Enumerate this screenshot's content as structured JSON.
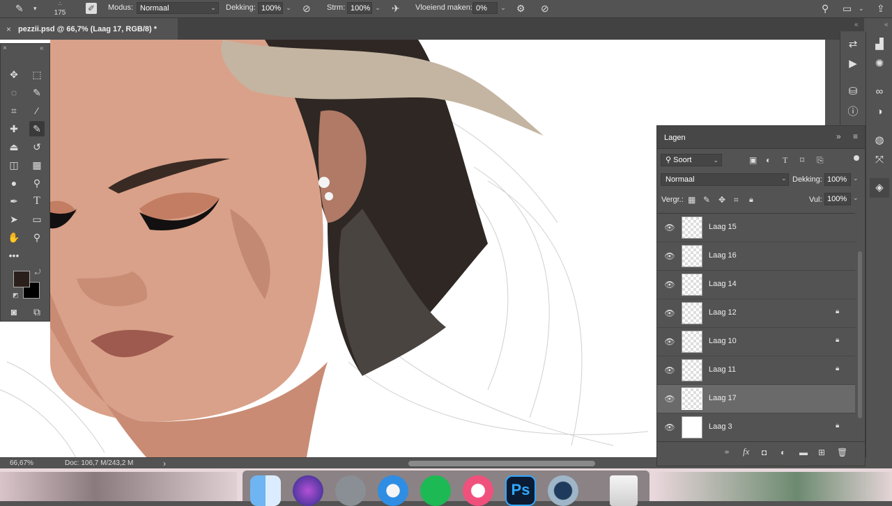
{
  "options_bar": {
    "brush_size": "175",
    "modus_label": "Modus:",
    "modus_value": "Normaal",
    "dekking_label": "Dekking:",
    "dekking_value": "100%",
    "strm_label": "Strm:",
    "strm_value": "100%",
    "vloeiend_label": "Vloeiend maken:",
    "vloeiend_value": "0%"
  },
  "document": {
    "tab_title": "pezzii.psd @ 66,7% (Laag 17, RGB/8) *",
    "close_glyph": "×"
  },
  "status_bar": {
    "zoom": "66,67%",
    "doc_info": "Doc: 106,7 M/243,2 M",
    "arrow": "›"
  },
  "colors": {
    "foreground": "#2b1f1c",
    "background": "#000000",
    "panel": "#535353",
    "selected_row": "#6a6a6a"
  },
  "layers_panel": {
    "title": "Lagen",
    "filter_label": "Soort",
    "blend_mode": "Normaal",
    "opacity_label": "Dekking:",
    "opacity_value": "100%",
    "lock_label": "Vergr.:",
    "fill_label": "Vul:",
    "fill_value": "100%",
    "layers": [
      {
        "name": "Laag 15",
        "locked": false,
        "selected": false
      },
      {
        "name": "Laag 16",
        "locked": false,
        "selected": false
      },
      {
        "name": "Laag 14",
        "locked": false,
        "selected": false
      },
      {
        "name": "Laag 12",
        "locked": true,
        "selected": false
      },
      {
        "name": "Laag 10",
        "locked": true,
        "selected": false
      },
      {
        "name": "Laag 11",
        "locked": true,
        "selected": false
      },
      {
        "name": "Laag 17",
        "locked": false,
        "selected": true
      },
      {
        "name": "Laag 3",
        "locked": true,
        "selected": false
      }
    ],
    "footer_fx": "fx"
  },
  "dock_apps": [
    "finder-icon",
    "siri-icon",
    "launchpad-icon",
    "safari-icon",
    "spotify-icon",
    "itunes-icon",
    "photoshop-icon",
    "quicktime-icon",
    "trash-icon"
  ],
  "dock_ps_label": "Ps"
}
